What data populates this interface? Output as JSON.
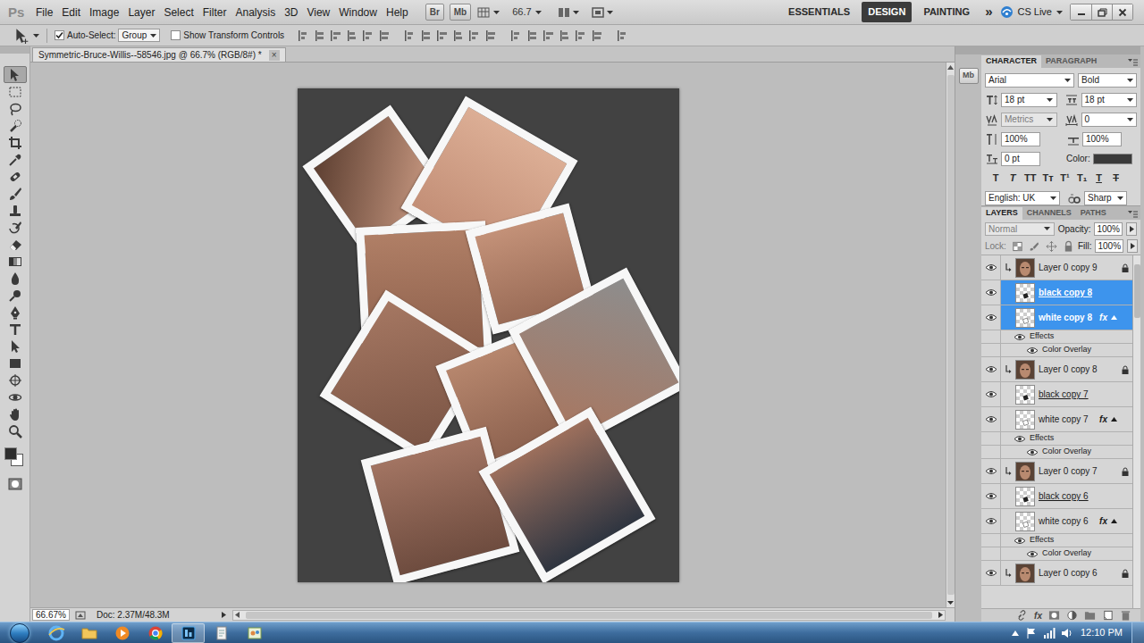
{
  "app": {
    "logo": "Ps",
    "bridge": "Br",
    "mini_bridge": "Mb",
    "zoom": "66.7"
  },
  "menu": [
    "File",
    "Edit",
    "Image",
    "Layer",
    "Select",
    "Filter",
    "Analysis",
    "3D",
    "View",
    "Window",
    "Help"
  ],
  "workspaces": [
    {
      "label": "ESSENTIALS",
      "selected": false
    },
    {
      "label": "DESIGN",
      "selected": true
    },
    {
      "label": "PAINTING",
      "selected": false
    }
  ],
  "workspace_more": "»",
  "cs_live": "CS Live",
  "options_bar": {
    "auto_select": {
      "label": "Auto-Select:",
      "checked": true
    },
    "target": "Group",
    "transform_controls": {
      "label": "Show Transform Controls",
      "checked": false
    }
  },
  "tools": [
    {
      "selected": true
    },
    {
      "selected": false
    },
    {
      "selected": false
    },
    {
      "selected": false
    },
    {
      "selected": false
    },
    {
      "selected": false
    },
    {
      "selected": false
    },
    {
      "selected": false
    },
    {
      "selected": false
    },
    {
      "selected": false
    },
    {
      "selected": false
    },
    {
      "selected": false
    },
    {
      "selected": false
    },
    {
      "selected": false
    },
    {
      "selected": false
    },
    {
      "selected": false
    },
    {
      "selected": false
    },
    {
      "selected": false
    },
    {
      "selected": false
    },
    {
      "selected": false
    },
    {
      "selected": false
    },
    {
      "selected": false
    }
  ],
  "document": {
    "title": "Symmetric-Bruce-Willis--58546.jpg @ 66.7% (RGB/8#) *",
    "close": "×"
  },
  "status_bar": {
    "zoom": "66.67%",
    "doc": "Doc: 2.37M/48.3M"
  },
  "dock": {
    "mini_bridge": "Mb"
  },
  "character": {
    "tabs": [
      {
        "label": "CHARACTER",
        "selected": true
      },
      {
        "label": "PARAGRAPH",
        "selected": false
      }
    ],
    "font_family": "Arial",
    "font_style": "Bold",
    "size": "18 pt",
    "leading": "18 pt",
    "kerning": {
      "value": "Metrics",
      "disabled": true
    },
    "tracking": "0",
    "vertical_scale": "100%",
    "horizontal_scale": "100%",
    "baseline_shift": "0 pt",
    "color_label": "Color:",
    "color": "#3a3a3a",
    "styles": [
      {
        "label": "T",
        "kind": "bold"
      },
      {
        "label": "T",
        "kind": "italic"
      },
      {
        "label": "TT",
        "kind": "caps"
      },
      {
        "label": "Tт",
        "kind": "smallcaps"
      },
      {
        "label": "T¹",
        "kind": "superscript"
      },
      {
        "label": "T₁",
        "kind": "subscript"
      },
      {
        "label": "T",
        "kind": "underline"
      },
      {
        "label": "T",
        "kind": "strikethrough"
      }
    ],
    "language": "English: UK",
    "antialias": "Sharp"
  },
  "layers_panel": {
    "tabs": [
      {
        "label": "LAYERS",
        "selected": true
      },
      {
        "label": "CHANNELS",
        "selected": false
      },
      {
        "label": "PATHS",
        "selected": false
      }
    ],
    "blend_mode": {
      "value": "Normal",
      "disabled": true
    },
    "opacity_label": "Opacity:",
    "opacity": "100%",
    "lock_label": "Lock:",
    "fill_label": "Fill:",
    "fill": "100%",
    "footer_fx": "fx",
    "layers": [
      {
        "kind": "layer",
        "name": "Layer 0 copy 9",
        "visible": true,
        "selected": false,
        "thumb": "photo",
        "clipped": true,
        "locked": true,
        "clip_base": false,
        "expanded": false
      },
      {
        "kind": "layer",
        "name": "black copy 8",
        "visible": true,
        "selected": true,
        "thumb": "black-shape",
        "clipped": false,
        "locked": false,
        "clip_base": true,
        "expanded": false
      },
      {
        "kind": "layer",
        "name": "white copy 8",
        "visible": true,
        "selected": true,
        "thumb": "white-shape",
        "clipped": false,
        "locked": false,
        "clip_base": false,
        "expanded": true,
        "fx": "fx"
      },
      {
        "kind": "effects",
        "name": "Effects",
        "visible": true,
        "selected": false
      },
      {
        "kind": "effect",
        "name": "Color Overlay",
        "visible": true,
        "selected": false
      },
      {
        "kind": "layer",
        "name": "Layer 0 copy 8",
        "visible": true,
        "selected": false,
        "thumb": "photo",
        "clipped": true,
        "locked": true,
        "clip_base": false,
        "expanded": false
      },
      {
        "kind": "layer",
        "name": "black copy 7",
        "visible": true,
        "selected": false,
        "thumb": "black-shape",
        "clipped": false,
        "locked": false,
        "clip_base": true,
        "expanded": false
      },
      {
        "kind": "layer",
        "name": "white copy 7",
        "visible": true,
        "selected": false,
        "thumb": "white-shape",
        "clipped": false,
        "locked": false,
        "clip_base": false,
        "expanded": true,
        "fx": "fx"
      },
      {
        "kind": "effects",
        "name": "Effects",
        "visible": true,
        "selected": false
      },
      {
        "kind": "effect",
        "name": "Color Overlay",
        "visible": true,
        "selected": false
      },
      {
        "kind": "layer",
        "name": "Layer 0 copy 7",
        "visible": true,
        "selected": false,
        "thumb": "photo",
        "clipped": true,
        "locked": true,
        "clip_base": false,
        "expanded": false
      },
      {
        "kind": "layer",
        "name": "black copy 6",
        "visible": true,
        "selected": false,
        "thumb": "black-shape",
        "clipped": false,
        "locked": false,
        "clip_base": true,
        "expanded": false
      },
      {
        "kind": "layer",
        "name": "white copy 6",
        "visible": true,
        "selected": false,
        "thumb": "white-shape",
        "clipped": false,
        "locked": false,
        "clip_base": false,
        "expanded": true,
        "fx": "fx"
      },
      {
        "kind": "effects",
        "name": "Effects",
        "visible": true,
        "selected": false
      },
      {
        "kind": "effect",
        "name": "Color Overlay",
        "visible": true,
        "selected": false
      },
      {
        "kind": "layer",
        "name": "Layer 0 copy 6",
        "visible": true,
        "selected": false,
        "thumb": "photo",
        "clipped": true,
        "locked": true,
        "clip_base": false,
        "expanded": false
      }
    ]
  },
  "taskbar": {
    "apps": [
      {
        "selected": false
      },
      {
        "selected": false
      },
      {
        "selected": false
      },
      {
        "selected": false
      },
      {
        "selected": true
      },
      {
        "selected": false
      },
      {
        "selected": false
      }
    ],
    "time": "12:10 PM"
  }
}
